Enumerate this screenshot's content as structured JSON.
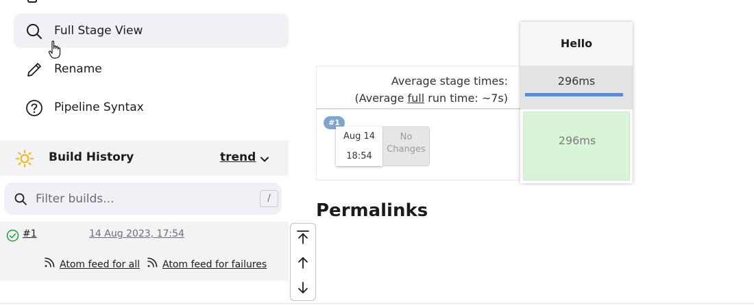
{
  "tasks": [
    {
      "label": "Full Stage View",
      "icon": "search-icon"
    },
    {
      "label": "Rename",
      "icon": "pencil-icon"
    },
    {
      "label": "Pipeline Syntax",
      "icon": "help-circle-icon"
    }
  ],
  "build_history": {
    "title": "Build History",
    "trend_label": "trend",
    "filter_placeholder": "Filter builds...",
    "filter_shortcut": "/",
    "builds": [
      {
        "number": "#1",
        "date": "14 Aug 2023, 17:54",
        "status": "success"
      }
    ],
    "feeds": {
      "all_label": "Atom feed for all",
      "failures_label": "Atom feed for failures"
    }
  },
  "stage_view": {
    "avg_stage_label": "Average stage times:",
    "avg_full_prefix": "(Average ",
    "avg_full_link": "full",
    "avg_full_suffix": " run time: ~7s)",
    "stage_name": "Hello",
    "stage_avg_time": "296ms",
    "stage_avg_fill": 1.0,
    "run": {
      "badge": "#1",
      "date": "Aug 14",
      "time": "18:54",
      "changes": "No Changes",
      "stage_time": "296ms",
      "status_color": "#d8f5d8"
    }
  },
  "permalinks_title": "Permalinks",
  "colors": {
    "accent_blue": "#5b8dd6",
    "success_green": "#1a9c3a",
    "sun_yellow": "#f2b705"
  }
}
